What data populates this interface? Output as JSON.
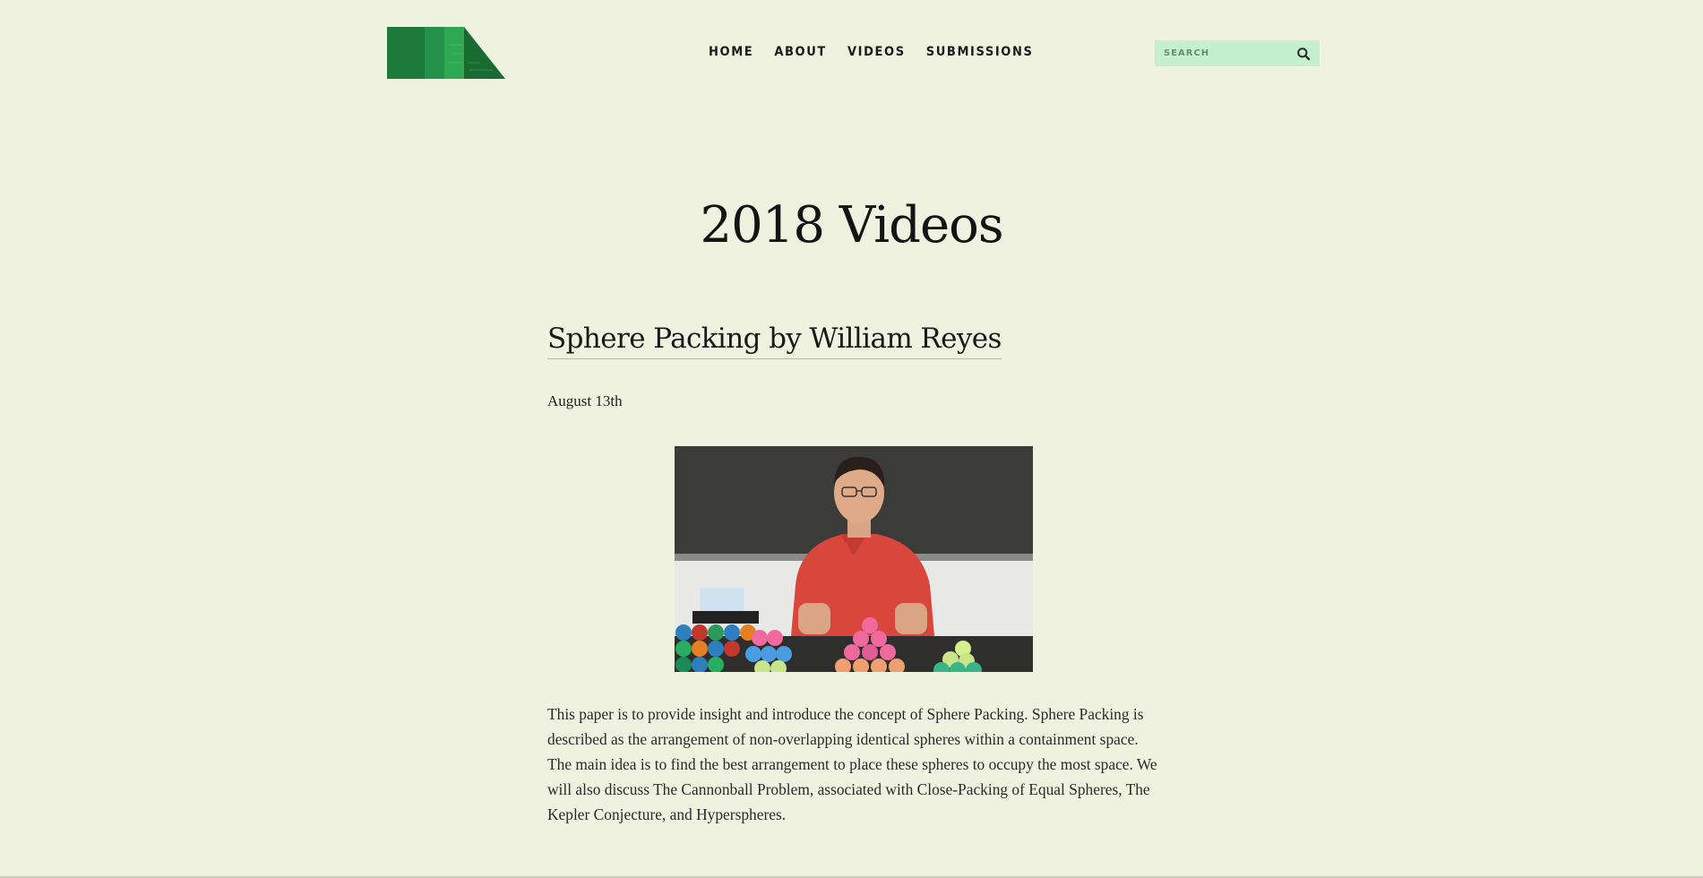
{
  "colors": {
    "background": "#f0f2e0",
    "search_bg": "#c4f0d0",
    "logo_dark": "#1d7a3a",
    "logo_light": "#2fa852"
  },
  "nav": {
    "items": [
      "HOME",
      "ABOUT",
      "VIDEOS",
      "SUBMISSIONS"
    ]
  },
  "search": {
    "placeholder": "SEARCH",
    "icon": "search-icon"
  },
  "page": {
    "title": "2018 Videos"
  },
  "post": {
    "title": "Sphere Packing by William Reyes",
    "date": "August 13th",
    "body": "This paper is to provide insight and introduce the concept of Sphere Packing. Sphere Packing is described as the arrangement of non-overlapping identical spheres within a containment space. The main idea is to find the best arrangement to place these spheres to occupy the most space. We will also discuss The Cannonball Problem, associated with Close-Packing of Equal Spheres, The Kepler Conjecture, and Hyperspheres."
  }
}
